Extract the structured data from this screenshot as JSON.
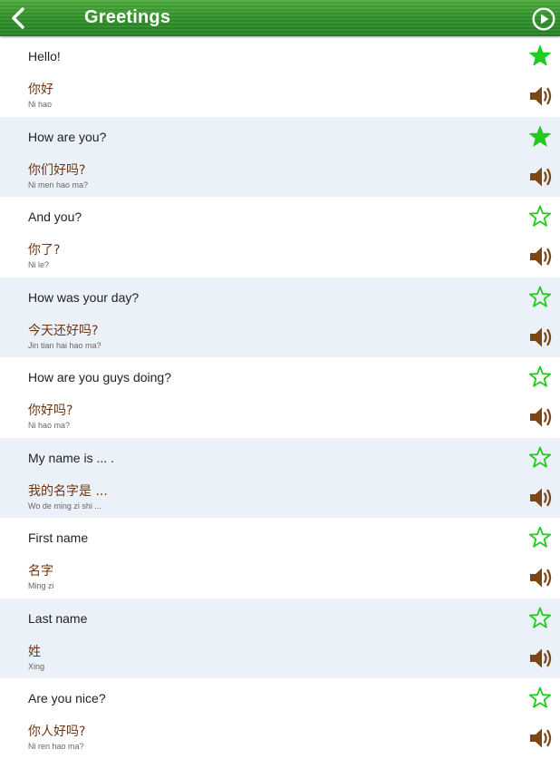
{
  "header": {
    "title": "Greetings"
  },
  "colors": {
    "header_green": "#2f8f29",
    "star_green": "#22cc1e",
    "speaker_brown": "#7a4718",
    "chinese_text": "#6e3512",
    "alt_row": "#eaf1f9"
  },
  "phrases": [
    {
      "english": "Hello!",
      "chinese": "你好",
      "pinyin": "Ni hao",
      "favorite": true
    },
    {
      "english": "How are you?",
      "chinese": "你们好吗?",
      "pinyin": "Ni men hao ma?",
      "favorite": true
    },
    {
      "english": "And you?",
      "chinese": "你了?",
      "pinyin": "Ni le?",
      "favorite": false
    },
    {
      "english": "How was your day?",
      "chinese": "今天还好吗?",
      "pinyin": "Jin tian hai hao ma?",
      "favorite": false
    },
    {
      "english": "How are you guys doing?",
      "chinese": "你好吗?",
      "pinyin": "Ni hao ma?",
      "favorite": false
    },
    {
      "english": "My name is ... .",
      "chinese": "我的名字是 ...",
      "pinyin": "Wo de ming zi shi ...",
      "favorite": false
    },
    {
      "english": "First name",
      "chinese": "名字",
      "pinyin": "Ming zi",
      "favorite": false
    },
    {
      "english": "Last name",
      "chinese": "姓",
      "pinyin": "Xing",
      "favorite": false
    },
    {
      "english": "Are you nice?",
      "chinese": "你人好吗?",
      "pinyin": "Ni ren hao ma?",
      "favorite": false
    }
  ]
}
